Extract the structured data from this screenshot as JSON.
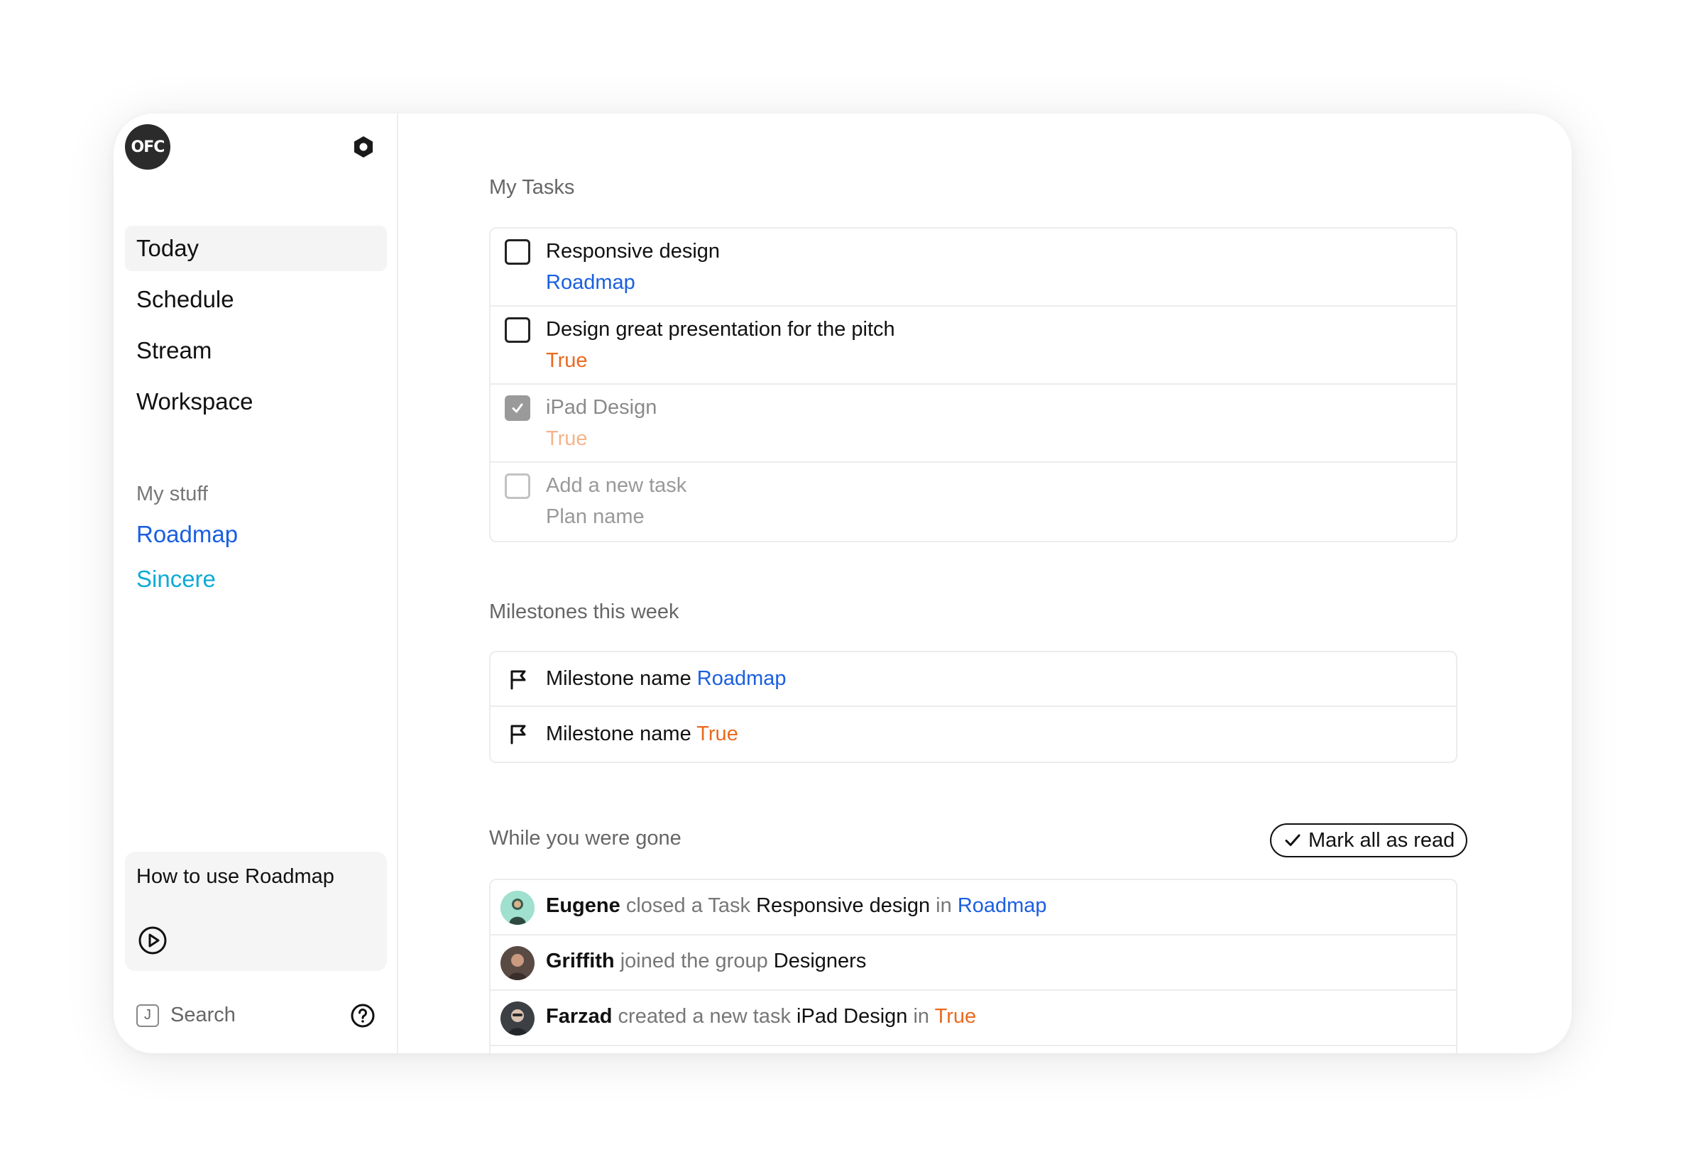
{
  "sidebar": {
    "logo_text": "OFC",
    "nav": [
      {
        "label": "Today",
        "active": true
      },
      {
        "label": "Schedule",
        "active": false
      },
      {
        "label": "Stream",
        "active": false
      },
      {
        "label": "Workspace",
        "active": false
      }
    ],
    "my_stuff_heading": "My stuff",
    "my_stuff": [
      {
        "label": "Roadmap",
        "color": "#1a5fe0"
      },
      {
        "label": "Sincere",
        "color": "#0eaad6"
      }
    ],
    "howto_label": "How to use Roadmap",
    "search_key": "J",
    "search_label": "Search"
  },
  "tasks": {
    "title": "My Tasks",
    "items": [
      {
        "title": "Responsive design",
        "plan": "Roadmap",
        "checked": false
      },
      {
        "title": "Design great presentation for the pitch",
        "plan": "True",
        "checked": false
      },
      {
        "title": "iPad Design",
        "plan": "True",
        "checked": true
      },
      {
        "title": "Add a new task",
        "plan": "Plan name",
        "checked": false,
        "placeholder": true
      }
    ]
  },
  "milestones": {
    "title": "Milestones this week",
    "items": [
      {
        "name": "Milestone name",
        "plan": "Roadmap"
      },
      {
        "name": "Milestone name",
        "plan": "True"
      }
    ]
  },
  "activity": {
    "title": "While you were gone",
    "mark_all_label": "Mark all as read",
    "items": [
      {
        "user": "Eugene",
        "action": "closed a Task",
        "object": "Responsive design",
        "prep": "in",
        "plan": "Roadmap"
      },
      {
        "user": "Griffith",
        "action": "joined the group",
        "object": "Designers"
      },
      {
        "user": "Farzad",
        "action": "created a new task",
        "object": "iPad Design",
        "prep": "in",
        "plan": "True"
      }
    ]
  },
  "colors": {
    "roadmap": "#1a5fe0",
    "true_plan": "#ea6a1f",
    "sincere": "#0eaad6"
  }
}
